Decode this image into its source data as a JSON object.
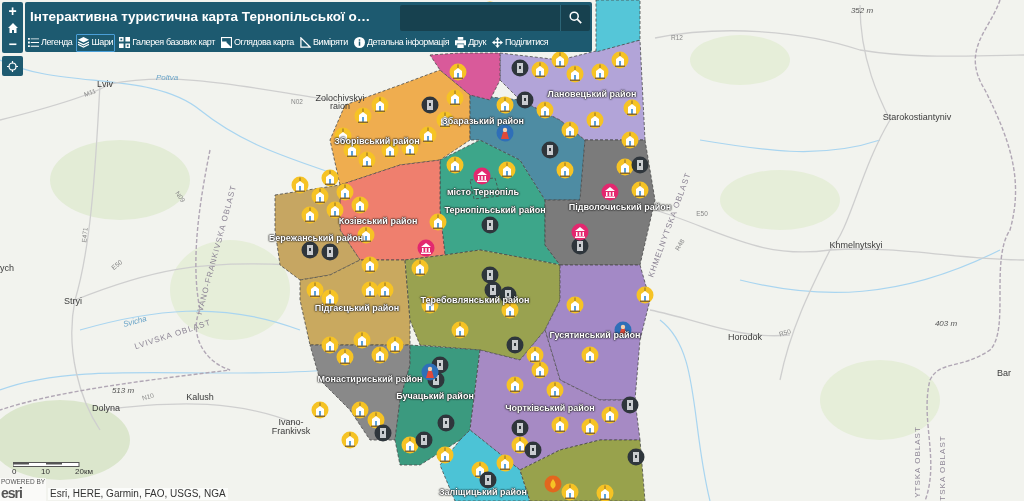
{
  "map_controls": {
    "zoom_in": "+",
    "zoom_out": "−"
  },
  "header": {
    "title": "Інтерактивна туристична карта Тернопільської о…"
  },
  "toolbar": [
    {
      "label": "Легенда",
      "selected": false
    },
    {
      "label": "Шари",
      "selected": true
    },
    {
      "label": "Галерея базових карт",
      "selected": false
    },
    {
      "label": "Оглядова карта",
      "selected": false
    },
    {
      "label": "Виміряти",
      "selected": false
    },
    {
      "label": "Детальна інформація",
      "selected": false
    },
    {
      "label": "Друк",
      "selected": false
    },
    {
      "label": "Поділитися",
      "selected": false
    }
  ],
  "districts": [
    {
      "label": "Зборівський район",
      "color": "#efad4f"
    },
    {
      "label": "Збаразький район",
      "color": "#4e8ca3"
    },
    {
      "label": "Лановецький район",
      "color": "#b2a4d8"
    },
    {
      "label": "місто Тернопіль",
      "color": "#3da68a"
    },
    {
      "label": "Тернопільський район",
      "color": "#3da68a"
    },
    {
      "label": "Підволочиський район",
      "color": "#7b7b7b"
    },
    {
      "label": "Козівський район",
      "color": "#ef7f6e"
    },
    {
      "label": "Бережанський район",
      "color": "#c6a662"
    },
    {
      "label": "Підгаєцький район",
      "color": "#c9a95f"
    },
    {
      "label": "Теребовлянський район",
      "color": "#99a250"
    },
    {
      "label": "Гусятинський район",
      "color": "#a389c6"
    },
    {
      "label": "Монастириський район",
      "color": "#898989"
    },
    {
      "label": "Бучацький район",
      "color": "#3b9a7f"
    },
    {
      "label": "Чортківський район",
      "color": "#a68ac4"
    },
    {
      "label": "Заліщицький район",
      "color": "#4cc3d6"
    },
    {
      "color": "#d95a9a"
    },
    {
      "color": "#55c6d8"
    },
    {
      "color": "#98a24c"
    }
  ],
  "map_labels": [
    {
      "text": "Lviv",
      "kind": "city"
    },
    {
      "text": "Zolochivskyi",
      "kind": "city"
    },
    {
      "text": "raion",
      "kind": "city"
    },
    {
      "text": "ych",
      "kind": "city"
    },
    {
      "text": "Stryi",
      "kind": "city"
    },
    {
      "text": "Kalush",
      "kind": "city"
    },
    {
      "text": "Dolyna",
      "kind": "city"
    },
    {
      "text": "Ivano-",
      "kind": "city"
    },
    {
      "text": "Frankivsk",
      "kind": "city"
    },
    {
      "text": "Starokostiantyniv",
      "kind": "city"
    },
    {
      "text": "Khmelnytskyi",
      "kind": "city"
    },
    {
      "text": "Horodok",
      "kind": "city"
    },
    {
      "text": "Bar",
      "kind": "city"
    },
    {
      "text": "352 m",
      "kind": "elevation"
    },
    {
      "text": "403 m",
      "kind": "elevation"
    },
    {
      "text": "513 m",
      "kind": "elevation"
    },
    {
      "text": "IVANO-FRANKIVSKA OBLAST",
      "kind": "region"
    },
    {
      "text": "LVIVSKA OBLAST",
      "kind": "region"
    },
    {
      "text": "KHMELNYTSKA OBLAST",
      "kind": "region"
    },
    {
      "text": "YTSKA OBLAST",
      "kind": "region"
    },
    {
      "text": "TSKA OBLAST",
      "kind": "region"
    },
    {
      "text": "M11",
      "kind": "road"
    },
    {
      "text": "N02",
      "kind": "road"
    },
    {
      "text": "N09",
      "kind": "road"
    },
    {
      "text": "E471",
      "kind": "road"
    },
    {
      "text": "E50",
      "kind": "road"
    },
    {
      "text": "N10",
      "kind": "road"
    },
    {
      "text": "R12",
      "kind": "road"
    },
    {
      "text": "E50",
      "kind": "road"
    },
    {
      "text": "R48",
      "kind": "road"
    },
    {
      "text": "R50",
      "kind": "road"
    },
    {
      "text": "Poltva",
      "kind": "river"
    },
    {
      "text": "Svicha",
      "kind": "river"
    }
  ],
  "scale_bar": {
    "labels": [
      "0",
      "10",
      "20км"
    ]
  },
  "attribution": {
    "logo_caption": "POWERED BY",
    "logo": "esri",
    "text": "Esri, HERE, Garmin, FAO, USGS, NGA"
  }
}
